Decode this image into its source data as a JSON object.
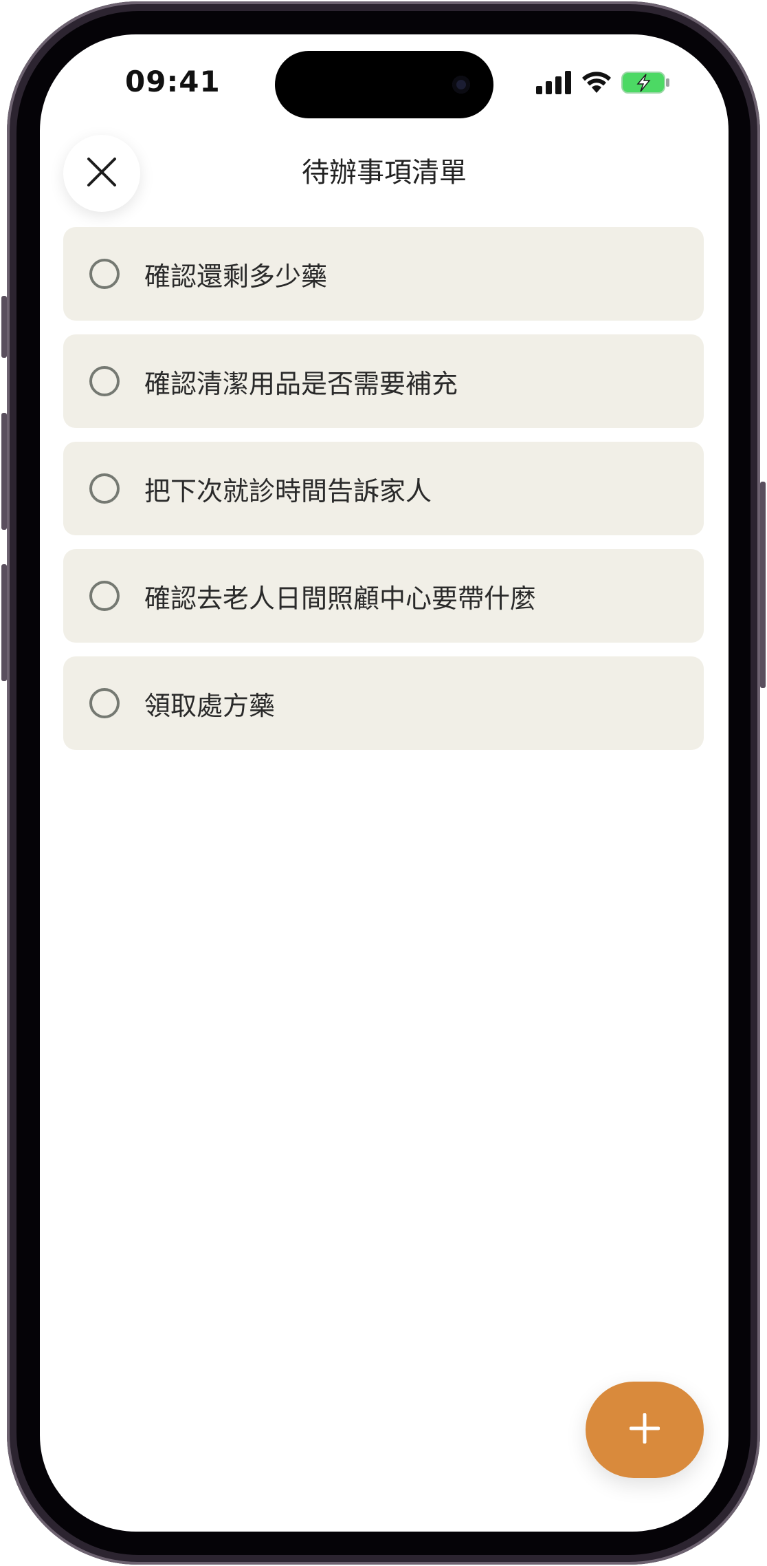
{
  "status_bar": {
    "time": "09:41"
  },
  "header": {
    "title": "待辦事項清單"
  },
  "todos": [
    {
      "text": "確認還剩多少藥",
      "done": false
    },
    {
      "text": "確認清潔用品是否需要補充",
      "done": false
    },
    {
      "text": "把下次就診時間告訴家人",
      "done": false
    },
    {
      "text": "確認去老人日間照顧中心要帶什麼",
      "done": false
    },
    {
      "text": "領取處方藥",
      "done": false
    }
  ],
  "icons": {
    "close": "close-icon",
    "add": "plus-icon",
    "signal": "cellular-signal-icon",
    "wifi": "wifi-icon",
    "battery": "battery-charging-icon"
  },
  "colors": {
    "accent": "#d98a3c",
    "card_background": "#f1efe7",
    "check_border": "#757972",
    "battery": "#4cd964"
  }
}
